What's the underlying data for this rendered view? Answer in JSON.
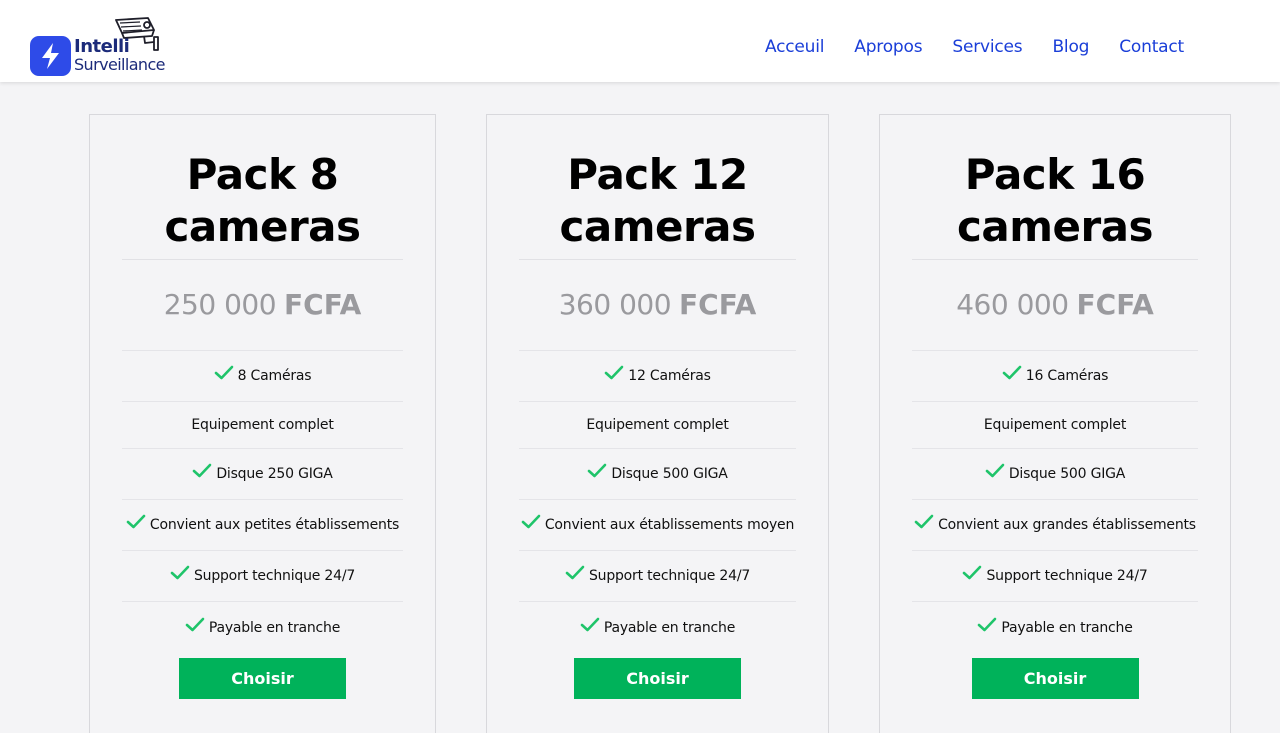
{
  "brand": {
    "name_line1": "Intelli",
    "name_line2": "Surveillance",
    "accent": "#2e4be8",
    "text_color": "#1c2b7a"
  },
  "nav": {
    "items": [
      "Acceuil",
      "Apropos",
      "Services",
      "Blog",
      "Contact"
    ],
    "color": "#1a3ed8"
  },
  "pricing": {
    "check_icon": "checkmark-icon",
    "check_color": "#1fc46a",
    "button_color": "#00b25a",
    "plans": [
      {
        "title_line1": "Pack 8",
        "title_line2": "cameras",
        "amount": "250 000",
        "currency": "FCFA",
        "features": [
          {
            "text": "8 Caméras",
            "check": true
          },
          {
            "text": "Equipement complet",
            "check": false
          },
          {
            "text": "Disque 250 GIGA",
            "check": true
          },
          {
            "text": "Convient aux petites établissements",
            "check": true
          },
          {
            "text": "Support technique 24/7",
            "check": true
          },
          {
            "text": "Payable en tranche",
            "check": true
          }
        ],
        "button": "Choisir"
      },
      {
        "title_line1": "Pack 12",
        "title_line2": "cameras",
        "amount": "360 000",
        "currency": "FCFA",
        "features": [
          {
            "text": "12 Caméras",
            "check": true
          },
          {
            "text": "Equipement complet",
            "check": false
          },
          {
            "text": "Disque 500 GIGA",
            "check": true
          },
          {
            "text": "Convient aux établissements moyen",
            "check": true
          },
          {
            "text": "Support technique 24/7",
            "check": true
          },
          {
            "text": "Payable en tranche",
            "check": true
          }
        ],
        "button": "Choisir"
      },
      {
        "title_line1": "Pack 16",
        "title_line2": "cameras",
        "amount": "460 000",
        "currency": "FCFA",
        "features": [
          {
            "text": "16 Caméras",
            "check": true
          },
          {
            "text": "Equipement complet",
            "check": false
          },
          {
            "text": "Disque 500 GIGA",
            "check": true
          },
          {
            "text": "Convient aux grandes établissements",
            "check": true
          },
          {
            "text": "Support technique 24/7",
            "check": true
          },
          {
            "text": "Payable en tranche",
            "check": true
          }
        ],
        "button": "Choisir"
      }
    ]
  }
}
